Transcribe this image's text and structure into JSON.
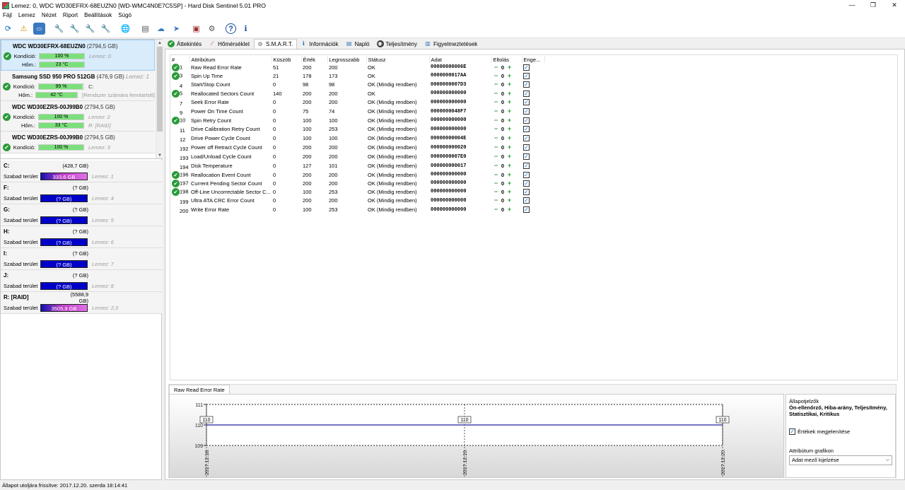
{
  "window": {
    "title": "Lemez: 0, WDC WD30EFRX-68EUZN0 [WD-WMC4N0E7C5SP]  -  Hard Disk Sentinel 5.01 PRO",
    "controls": [
      "—",
      "❐",
      "✕"
    ]
  },
  "menu": [
    "Fájl",
    "Lemez",
    "Nézet",
    "Riport",
    "Beállítások",
    "Súgó"
  ],
  "toolbar": {
    "icons": [
      "refresh-icon",
      "alert-icon",
      "drive-icon",
      "wrench-icon",
      "wrench-add-icon",
      "wrench-ok-icon",
      "wrench-tool-icon",
      "globe-icon",
      "report-icon",
      "cloud-send-icon",
      "send-icon",
      "monitor-icon",
      "settings-icon",
      "help-icon",
      "info-icon"
    ]
  },
  "disks": [
    {
      "name": "WDC WD30EFRX-68EUZN0",
      "size": "(2794,5 GB)",
      "kond_label": "Kondíció:",
      "kond": "100 %",
      "kond_pct": 100,
      "kond_extra": "Lemez: 0",
      "hom_label": "Hőm.:",
      "hom": "23 °C",
      "hom_extra": ""
    },
    {
      "name": "Samsung SSD 950 PRO 512GB",
      "size": "(476,9 GB)",
      "extra": "Lemez: 1",
      "kond_label": "Kondíció:",
      "kond": "99 %",
      "kond_pct": 99,
      "kond_extra": "C:",
      "hom_label": "Hőm.:",
      "hom": "42 °C",
      "hom_extra": "[Rendszer számára fenntartott]"
    },
    {
      "name": "WDC WD30EZRS-00J99B0",
      "size": "(2794,5 GB)",
      "kond_label": "Kondíció:",
      "kond": "100 %",
      "kond_pct": 100,
      "kond_extra": "Lemez: 2",
      "hom_label": "Hőm.:",
      "hom": "33 °C",
      "hom_extra": "R: [RAID]"
    },
    {
      "name": "WDC WD30EZRS-00J99B0",
      "size": "(2794,5 GB)",
      "kond_label": "Kondíció:",
      "kond": "100 %",
      "kond_pct": 100,
      "kond_extra": "Lemez: 3"
    }
  ],
  "volumes": [
    {
      "letter": "C:",
      "size": "(428,7 GB)",
      "free_label": "Szabad terület",
      "free": "333,6 GB",
      "disk": "Lemez: 1",
      "style": "mag"
    },
    {
      "letter": "F:",
      "size": "(? GB)",
      "free_label": "Szabad terület",
      "free": "(? GB)",
      "disk": "Lemez: 4",
      "style": "blue"
    },
    {
      "letter": "G:",
      "size": "(? GB)",
      "free_label": "Szabad terület",
      "free": "(? GB)",
      "disk": "Lemez: 5",
      "style": "blue"
    },
    {
      "letter": "H:",
      "size": "(? GB)",
      "free_label": "Szabad terület",
      "free": "(? GB)",
      "disk": "Lemez: 6",
      "style": "blue"
    },
    {
      "letter": "I:",
      "size": "(? GB)",
      "free_label": "Szabad terület",
      "free": "(? GB)",
      "disk": "Lemez: 7",
      "style": "blue"
    },
    {
      "letter": "J:",
      "size": "(? GB)",
      "free_label": "Szabad terület",
      "free": "(? GB)",
      "disk": "Lemez: 8",
      "style": "blue"
    },
    {
      "letter": "R: [RAID]",
      "size": "(5588,9 GB)",
      "free_label": "Szabad terület",
      "free": "3505,9 GB",
      "disk": "Lemez: 2,3",
      "style": "mag"
    }
  ],
  "tabs": [
    {
      "label": "Áttekintés",
      "icon": "check-icon",
      "glyph": "✔"
    },
    {
      "label": "Hőmérséklet",
      "icon": "thermometer-icon",
      "glyph": "🌡"
    },
    {
      "label": "S.M.A.R.T.",
      "icon": "smart-icon",
      "glyph": "⚙",
      "active": true
    },
    {
      "label": "Információk",
      "icon": "info-icon",
      "glyph": "ℹ"
    },
    {
      "label": "Napló",
      "icon": "log-icon",
      "glyph": "▤"
    },
    {
      "label": "Teljesítmény",
      "icon": "performance-icon",
      "glyph": "◉"
    },
    {
      "label": "Figyelmeztetések",
      "icon": "alert-icon",
      "glyph": "▥"
    }
  ],
  "smart": {
    "headers": [
      "#",
      "Attribútum",
      "Küszöb",
      "Érték",
      "Legrosszabb",
      "Státusz",
      "Adat",
      "Eltolás",
      "Enge..."
    ],
    "rows": [
      {
        "ok": true,
        "id": "1",
        "name": "Raw Read Error Rate",
        "thr": "51",
        "val": "200",
        "worst": "200",
        "status": "OK",
        "data": "00000000006E"
      },
      {
        "ok": true,
        "id": "3",
        "name": "Spin Up Time",
        "thr": "21",
        "val": "178",
        "worst": "173",
        "status": "OK",
        "data": "0000000017AA"
      },
      {
        "ok": false,
        "id": "4",
        "name": "Start/Stop Count",
        "thr": "0",
        "val": "98",
        "worst": "98",
        "status": "OK (Mindig rendben)",
        "data": "0000000007D3"
      },
      {
        "ok": true,
        "id": "5",
        "name": "Reallocated Sectors Count",
        "thr": "140",
        "val": "200",
        "worst": "200",
        "status": "OK",
        "data": "000000000000"
      },
      {
        "ok": false,
        "id": "7",
        "name": "Seek Error Rate",
        "thr": "0",
        "val": "200",
        "worst": "200",
        "status": "OK (Mindig rendben)",
        "data": "000000000000"
      },
      {
        "ok": false,
        "id": "9",
        "name": "Power On Time Count",
        "thr": "0",
        "val": "75",
        "worst": "74",
        "status": "OK (Mindig rendben)",
        "data": "0000000048F7"
      },
      {
        "ok": true,
        "id": "10",
        "name": "Spin Retry Count",
        "thr": "0",
        "val": "100",
        "worst": "100",
        "status": "OK (Mindig rendben)",
        "data": "000000000000"
      },
      {
        "ok": false,
        "id": "11",
        "name": "Drive Calibration Retry Count",
        "thr": "0",
        "val": "100",
        "worst": "253",
        "status": "OK (Mindig rendben)",
        "data": "000000000000"
      },
      {
        "ok": false,
        "id": "12",
        "name": "Drive Power Cycle Count",
        "thr": "0",
        "val": "100",
        "worst": "100",
        "status": "OK (Mindig rendben)",
        "data": "00000000004E"
      },
      {
        "ok": false,
        "id": "192",
        "name": "Power off Retract Cycle Count",
        "thr": "0",
        "val": "200",
        "worst": "200",
        "status": "OK (Mindig rendben)",
        "data": "000000000020"
      },
      {
        "ok": false,
        "id": "193",
        "name": "Load/Unload Cycle Count",
        "thr": "0",
        "val": "200",
        "worst": "200",
        "status": "OK (Mindig rendben)",
        "data": "0000000007E0"
      },
      {
        "ok": false,
        "id": "194",
        "name": "Disk Temperature",
        "thr": "0",
        "val": "127",
        "worst": "101",
        "status": "OK (Mindig rendben)",
        "data": "000000000017"
      },
      {
        "ok": true,
        "id": "196",
        "name": "Reallocation Event Count",
        "thr": "0",
        "val": "200",
        "worst": "200",
        "status": "OK (Mindig rendben)",
        "data": "000000000000"
      },
      {
        "ok": true,
        "id": "197",
        "name": "Current Pending Sector Count",
        "thr": "0",
        "val": "200",
        "worst": "200",
        "status": "OK (Mindig rendben)",
        "data": "000000000000"
      },
      {
        "ok": true,
        "id": "198",
        "name": "Off-Line Uncorrectable Sector C...",
        "thr": "0",
        "val": "100",
        "worst": "253",
        "status": "OK (Mindig rendben)",
        "data": "000000000000"
      },
      {
        "ok": false,
        "id": "199",
        "name": "Ultra ATA CRC Error Count",
        "thr": "0",
        "val": "200",
        "worst": "200",
        "status": "OK (Mindig rendben)",
        "data": "000000000000"
      },
      {
        "ok": false,
        "id": "200",
        "name": "Write Error Rate",
        "thr": "0",
        "val": "100",
        "worst": "253",
        "status": "OK (Mindig rendben)",
        "data": "000000000000"
      }
    ],
    "offset": "0"
  },
  "graph": {
    "tab": "Raw Read Error Rate",
    "side_heading": "Állapotjelzők",
    "side_text": "Ön-ellenőrző, Hiba-arány, Teljesítmény, Statisztikai, Kritikus",
    "checkbox_label": "Értékek megjelenítése",
    "dropdown_label": "Attribútum grafikon",
    "dropdown_value": "Adat mező kijelzése"
  },
  "chart_data": {
    "type": "line",
    "x": [
      "2017.12.18.",
      "2017.12.19.",
      "2017.12.20."
    ],
    "series": [
      {
        "values": [
          110,
          110,
          110
        ]
      }
    ],
    "ylim": [
      109,
      111
    ],
    "yticks": [
      "111",
      "110",
      "109"
    ],
    "data_labels": [
      "110",
      "110",
      "110"
    ],
    "grid": true,
    "line_color": "#2020a0"
  },
  "status": "Állapot utoljára frissítve: 2017.12.20. szerda 18:14:41"
}
